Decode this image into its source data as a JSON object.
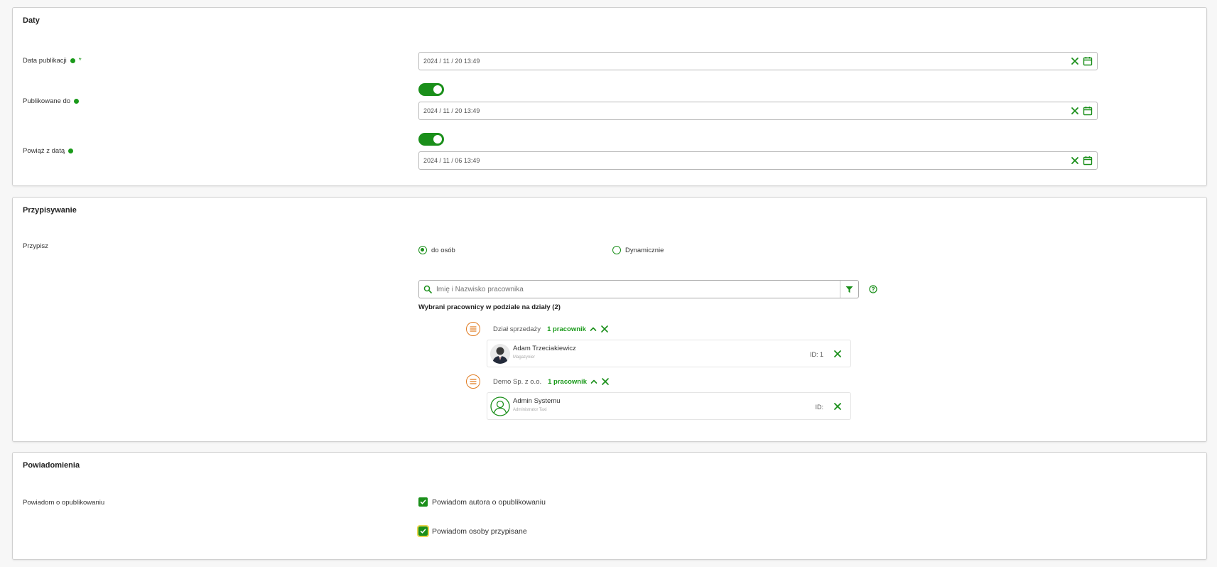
{
  "sections": {
    "dates": {
      "title": "Daty",
      "publish_date": {
        "label": "Data publikacji",
        "required_mark": "*",
        "value": "2024 / 11 / 20 13:49"
      },
      "published_until": {
        "label": "Publikowane do",
        "toggle_on": true,
        "value": "2024 / 11 / 20 13:49"
      },
      "link_date": {
        "label": "Powiąż z datą",
        "toggle_on": true,
        "value": "2024 / 11 / 06 13:49"
      }
    },
    "assign": {
      "title": "Przypisywanie",
      "label": "Przypisz",
      "radio_people": "do osób",
      "radio_dynamic": "Dynamicznie",
      "search_placeholder": "Imię i Nazwisko pracownika",
      "selected_title": "Wybrani pracownicy w podziale na działy (2)",
      "departments": [
        {
          "name": "Dział sprzedaży",
          "count": "1 pracownik",
          "person": {
            "name": "Adam Trzeciakiewicz",
            "role": "Magazynier",
            "id": "ID: 1"
          }
        },
        {
          "name": "Demo Sp. z o.o.",
          "count": "1 pracownik",
          "person": {
            "name": "Admin Systemu",
            "role": "Administrator Taxi",
            "id": "ID:"
          }
        }
      ]
    },
    "notifications": {
      "title": "Powiadomienia",
      "label": "Powiadom o opublikowaniu",
      "notify_author": "Powiadom autora o opublikowaniu",
      "notify_assigned": "Powiadom osoby przypisane"
    }
  },
  "colors": {
    "accent": "#1a8f1a",
    "dept_icon": "#e07a1f"
  }
}
